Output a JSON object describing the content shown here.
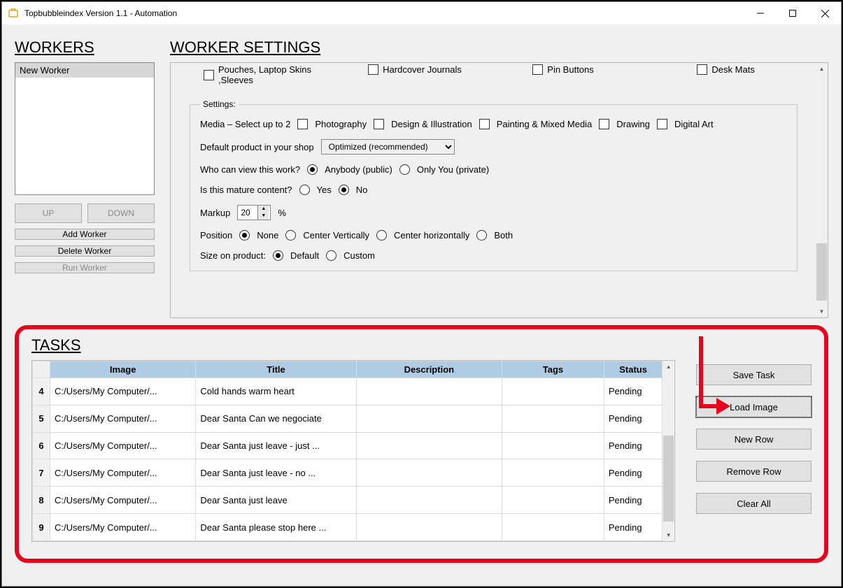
{
  "window": {
    "title": "Topbubbleindex Version 1.1 - Automation"
  },
  "headings": {
    "workers": "WORKERS",
    "settings": "WORKER SETTINGS",
    "tasks": "TASKS"
  },
  "workers": {
    "items": [
      "New Worker"
    ],
    "buttons": {
      "up": "UP",
      "down": "DOWN",
      "add": "Add Worker",
      "del": "Delete Worker",
      "run": "Run Worker"
    }
  },
  "product_checks": {
    "row1": [
      "Pouches, Laptop Skins ,Sleeves",
      "Hardcover Journals",
      "Pin Buttons",
      "Desk Mats"
    ]
  },
  "settings": {
    "legend": "Settings:",
    "media_label": "Media – Select up to 2",
    "media": [
      "Photography",
      "Design & Illustration",
      "Painting & Mixed Media",
      "Drawing",
      "Digital Art"
    ],
    "default_prod_label": "Default product in your shop",
    "default_prod_value": "Optimized (recommended)",
    "view_label": "Who can view this work?",
    "view_opts": [
      "Anybody (public)",
      "Only You (private)"
    ],
    "mature_label": "Is this mature content?",
    "mature_opts": [
      "Yes",
      "No"
    ],
    "markup_label": "Markup",
    "markup_value": "20",
    "markup_pct": "%",
    "position_label": "Position",
    "position_opts": [
      "None",
      "Center Vertically",
      "Center horizontally",
      "Both"
    ],
    "size_label": "Size on product:",
    "size_opts": [
      "Default",
      "Custom"
    ]
  },
  "table": {
    "headers": [
      "Image",
      "Title",
      "Description",
      "Tags",
      "Status"
    ],
    "rows": [
      {
        "n": "4",
        "image": "C:/Users/My Computer/...",
        "title": "Cold hands warm heart",
        "desc": "",
        "tags": "",
        "status": "Pending"
      },
      {
        "n": "5",
        "image": "C:/Users/My Computer/...",
        "title": "Dear Santa Can we negociate",
        "desc": "",
        "tags": "",
        "status": "Pending"
      },
      {
        "n": "6",
        "image": "C:/Users/My Computer/...",
        "title": "Dear Santa just leave - just ...",
        "desc": "",
        "tags": "",
        "status": "Pending"
      },
      {
        "n": "7",
        "image": "C:/Users/My Computer/...",
        "title": "Dear Santa just leave - no ...",
        "desc": "",
        "tags": "",
        "status": "Pending"
      },
      {
        "n": "8",
        "image": "C:/Users/My Computer/...",
        "title": "Dear Santa just leave",
        "desc": "",
        "tags": "",
        "status": "Pending"
      },
      {
        "n": "9",
        "image": "C:/Users/My Computer/...",
        "title": "Dear Santa please stop here ...",
        "desc": "",
        "tags": "",
        "status": "Pending"
      }
    ]
  },
  "task_buttons": {
    "save": "Save Task",
    "load": "Load Image",
    "newrow": "New Row",
    "remove": "Remove Row",
    "clear": "Clear All"
  }
}
